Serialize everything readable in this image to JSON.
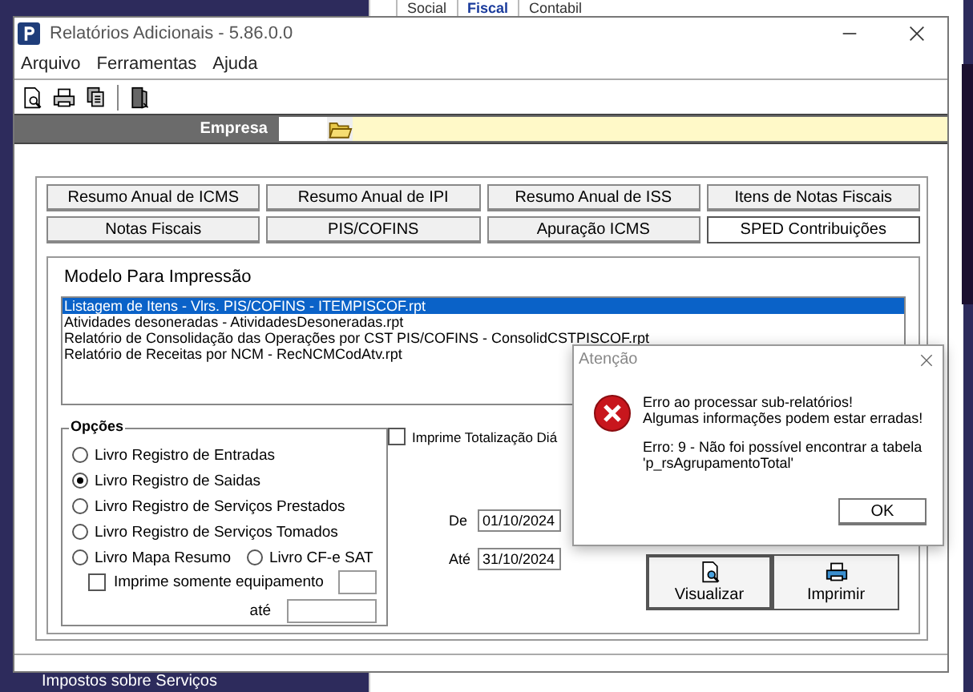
{
  "background_window": {
    "tabs": [
      {
        "label": "Social",
        "selected": false
      },
      {
        "label": "Fiscal",
        "selected": true
      },
      {
        "label": "Contabil",
        "selected": false
      }
    ],
    "tree_item": "Impostos sobre Serviços"
  },
  "window": {
    "title": "Relatórios Adicionais - 5.86.0.0"
  },
  "menu": [
    "Arquivo",
    "Ferramentas",
    "Ajuda"
  ],
  "empresa": {
    "label": "Empresa"
  },
  "report_tabs": [
    {
      "label": "Resumo Anual de ICMS",
      "selected": false
    },
    {
      "label": "Resumo Anual de IPI",
      "selected": false
    },
    {
      "label": "Resumo Anual de ISS",
      "selected": false
    },
    {
      "label": "Itens de Notas Fiscais",
      "selected": false
    },
    {
      "label": "Notas Fiscais",
      "selected": false
    },
    {
      "label": "PIS/COFINS",
      "selected": false
    },
    {
      "label": "Apuração ICMS",
      "selected": false
    },
    {
      "label": "SPED Contribuições",
      "selected": true
    }
  ],
  "model_group": {
    "title": "Modelo Para Impressão",
    "items": [
      {
        "label": "Listagem de Itens - Vlrs. PIS/COFINS - ITEMPISCOF.rpt",
        "selected": true
      },
      {
        "label": "Atividades desoneradas - AtividadesDesoneradas.rpt",
        "selected": false
      },
      {
        "label": "Relatório de Consolidação das Operações por CST PIS/COFINS - ConsolidCSTPISCOF.rpt",
        "selected": false
      },
      {
        "label": "Relatório de Receitas por NCM - RecNCMCodAtv.rpt",
        "selected": false
      }
    ]
  },
  "options": {
    "title": "Opções",
    "radios": [
      {
        "label": "Livro Registro de Entradas",
        "selected": false
      },
      {
        "label": "Livro Registro de Saidas",
        "selected": true
      },
      {
        "label": "Livro Registro de Serviços Prestados",
        "selected": false
      },
      {
        "label": "Livro Registro de Serviços Tomados",
        "selected": false
      },
      {
        "label": "Livro Mapa Resumo",
        "selected": false
      },
      {
        "label": "Livro CF-e SAT",
        "selected": false
      }
    ],
    "equipment_checkbox": {
      "label": "Imprime somente equipamento",
      "checked": false
    },
    "until_label": "até"
  },
  "daily_total": {
    "label": "Imprime Totalização Diá",
    "checked": false
  },
  "date_from": {
    "label": "De",
    "value": "01/10/2024"
  },
  "date_to": {
    "label": "Até",
    "value": "31/10/2024"
  },
  "actions": [
    {
      "label": "Visualizar",
      "kind": "preview"
    },
    {
      "label": "Imprimir",
      "kind": "print"
    }
  ],
  "dialog": {
    "title": "Atenção",
    "lines": [
      "Erro ao processar sub-relatórios!",
      "Algumas informações podem estar erradas!"
    ],
    "detail": [
      "Erro: 9 - Não foi possível encontrar a tabela",
      "'p_rsAgrupamentoTotal'"
    ],
    "button": "OK"
  }
}
